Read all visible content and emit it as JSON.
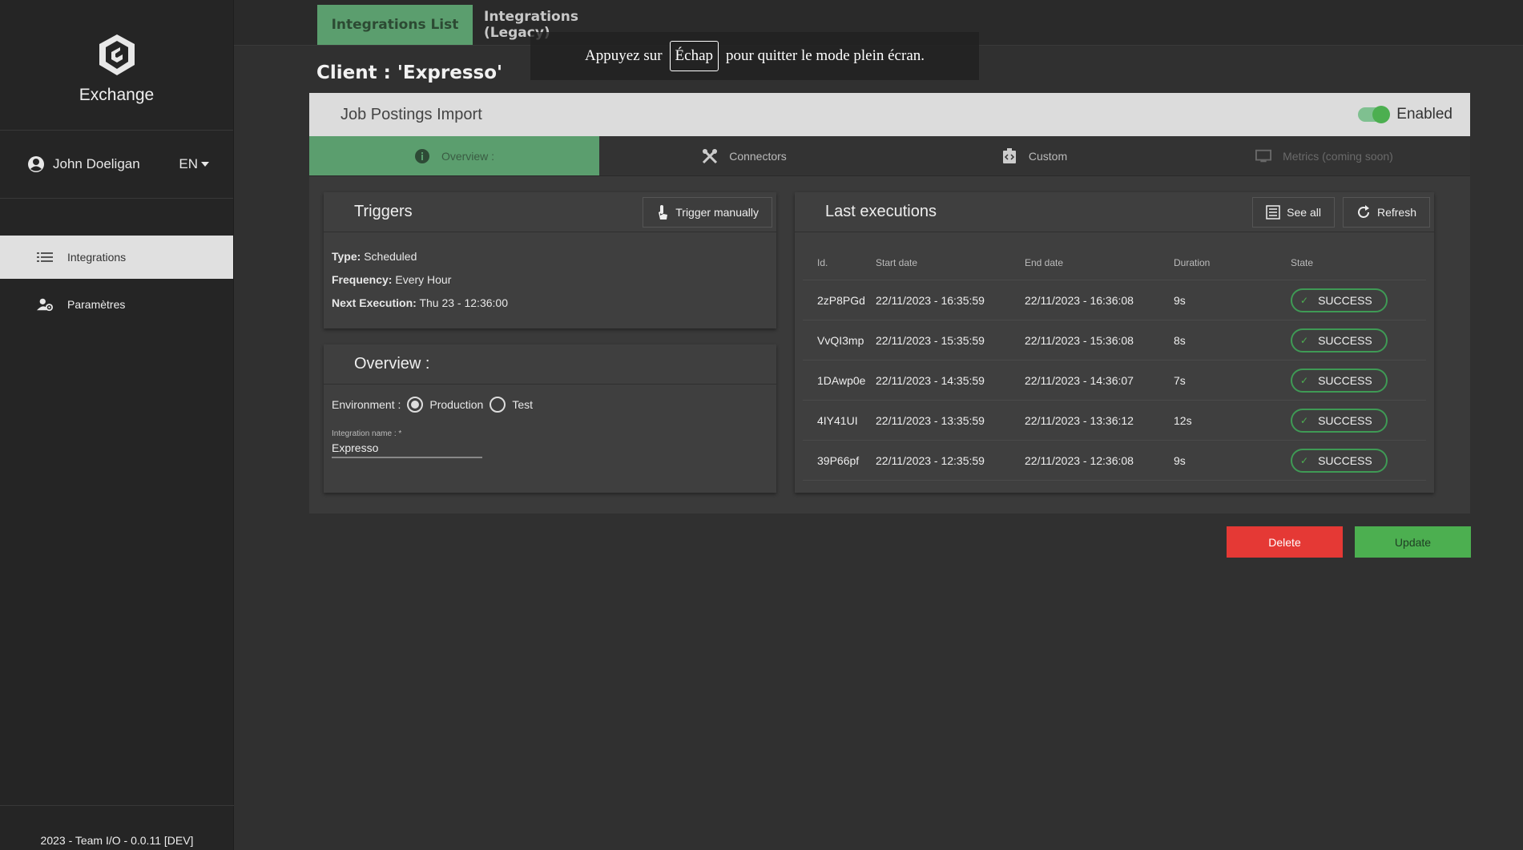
{
  "sidebar": {
    "brand": "Exchange",
    "user": "John Doeligan",
    "language": "EN",
    "items": [
      {
        "label": "Integrations"
      },
      {
        "label": "Paramètres"
      }
    ],
    "footer": "2023 - Team I/O - 0.0.11 [DEV]"
  },
  "top_tabs": [
    "Integrations List",
    "Integrations (Legacy)"
  ],
  "client_title": "Client : 'Expresso'",
  "fullscreen_notice": {
    "before": "Appuyez sur",
    "key": "Échap",
    "after": "pour quitter le mode plein écran."
  },
  "panel": {
    "title": "Job Postings Import",
    "enabled_label": "Enabled",
    "tabs": [
      "Overview :",
      "Connectors",
      "Custom",
      "Metrics (coming soon)"
    ]
  },
  "triggers": {
    "title": "Triggers",
    "button": "Trigger manually",
    "type_label": "Type:",
    "type_value": "Scheduled",
    "frequency_label": "Frequency:",
    "frequency_value": "Every Hour",
    "next_label": "Next Execution:",
    "next_value": "Thu 23 - 12:36:00"
  },
  "overview": {
    "title": "Overview :",
    "env_label": "Environment :",
    "env_options": [
      "Production",
      "Test"
    ],
    "env_selected": "Production",
    "name_label": "Integration name : *",
    "name_value": "Expresso"
  },
  "executions": {
    "title": "Last executions",
    "see_all": "See all",
    "refresh": "Refresh",
    "columns": [
      "Id.",
      "Start date",
      "End date",
      "Duration",
      "State"
    ],
    "rows": [
      {
        "id": "2zP8PGd",
        "start": "22/11/2023 - 16:35:59",
        "end": "22/11/2023 - 16:36:08",
        "duration": "9s",
        "state": "SUCCESS"
      },
      {
        "id": "VvQI3mp",
        "start": "22/11/2023 - 15:35:59",
        "end": "22/11/2023 - 15:36:08",
        "duration": "8s",
        "state": "SUCCESS"
      },
      {
        "id": "1DAwp0e",
        "start": "22/11/2023 - 14:35:59",
        "end": "22/11/2023 - 14:36:07",
        "duration": "7s",
        "state": "SUCCESS"
      },
      {
        "id": "4IY41UI",
        "start": "22/11/2023 - 13:35:59",
        "end": "22/11/2023 - 13:36:12",
        "duration": "12s",
        "state": "SUCCESS"
      },
      {
        "id": "39P66pf",
        "start": "22/11/2023 - 12:35:59",
        "end": "22/11/2023 - 12:36:08",
        "duration": "9s",
        "state": "SUCCESS"
      }
    ]
  },
  "actions": {
    "delete": "Delete",
    "update": "Update"
  },
  "colors": {
    "accent_green": "#5b9e6e",
    "success": "#4caf50",
    "danger": "#e53935"
  }
}
